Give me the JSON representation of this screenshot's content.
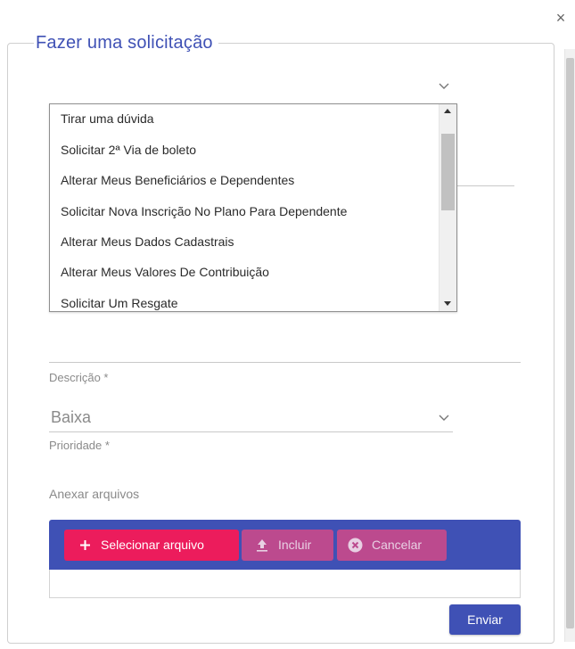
{
  "dialog": {
    "title": "Fazer uma solicitação",
    "close_glyph": "×"
  },
  "request_type": {
    "options": [
      "Tirar uma dúvida",
      "Solicitar 2ª Via de boleto",
      "Alterar Meus Beneficiários e Dependentes",
      "Solicitar Nova Inscrição No Plano Para Dependente",
      "Alterar Meus Dados Cadastrais",
      "Alterar Meus Valores De Contribuição",
      "Solicitar Um Resgate"
    ]
  },
  "description": {
    "label": "Descrição *"
  },
  "priority": {
    "value": "Baixa",
    "label": "Prioridade *"
  },
  "attachments": {
    "label": "Anexar arquivos",
    "select_label": "Selecionar arquivo",
    "include_label": "Incluir",
    "cancel_label": "Cancelar"
  },
  "actions": {
    "send_label": "Enviar"
  },
  "colors": {
    "primary": "#3f51b5",
    "accent": "#ec1c5c",
    "accent_disabled": "#c34a8c"
  }
}
